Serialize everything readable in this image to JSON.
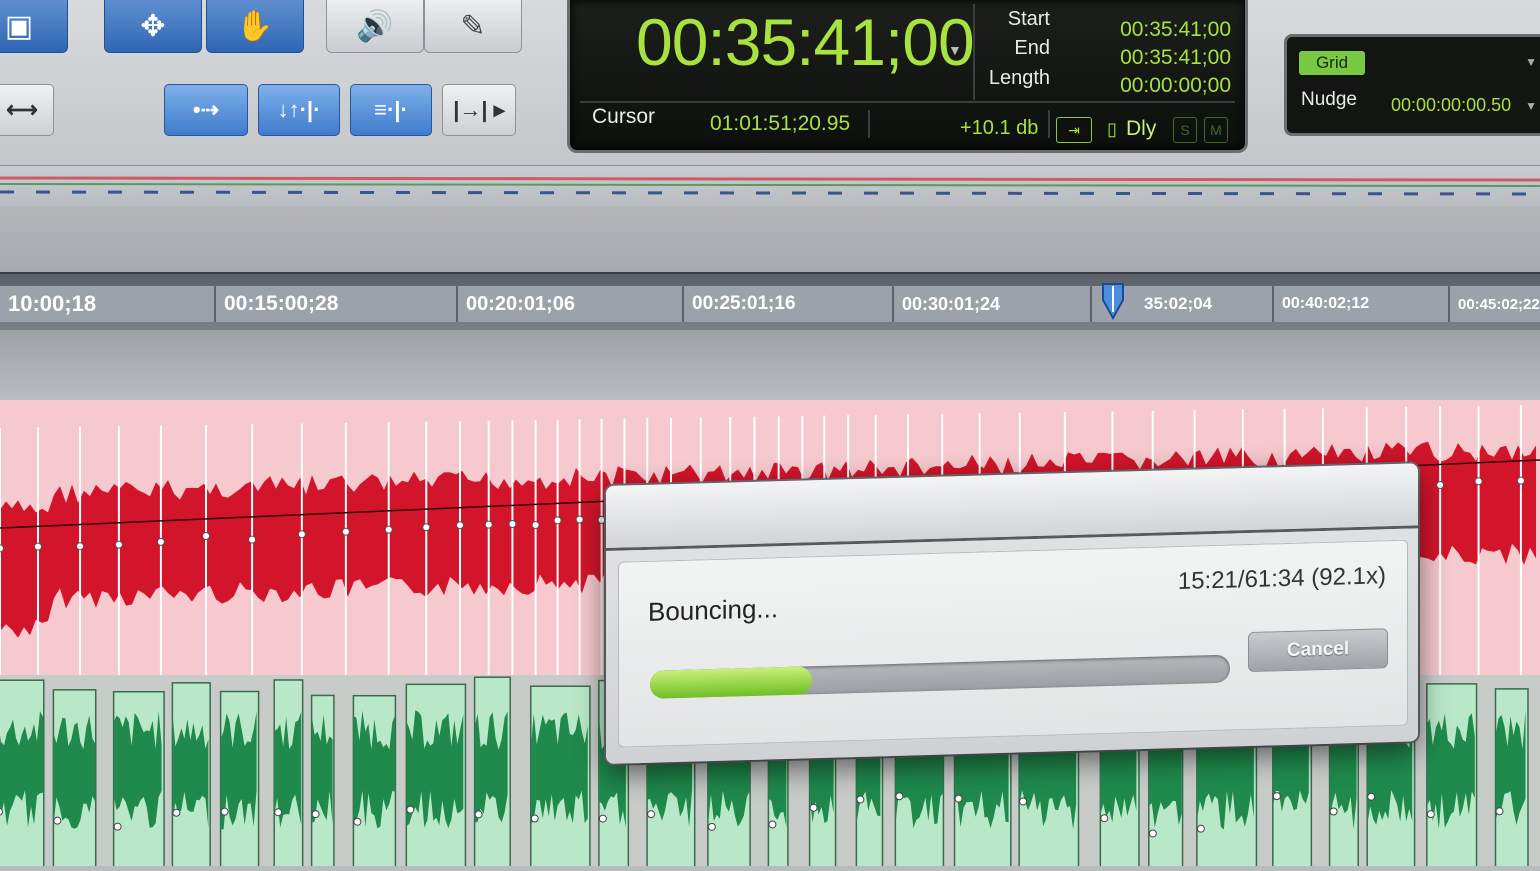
{
  "tools": [
    {
      "icon": "zoom-icon"
    },
    {
      "icon": "trim-icon"
    },
    {
      "icon": "grabber-hand-icon"
    },
    {
      "icon": "speaker-icon"
    },
    {
      "icon": "pencil-icon"
    }
  ],
  "edit_tools": [
    {
      "icon": "link-icon"
    },
    {
      "icon": "spot-icon"
    },
    {
      "icon": "slip-icon"
    },
    {
      "icon": "grid-mode-icon"
    },
    {
      "icon": "nudge-icon"
    }
  ],
  "counter": {
    "main": "00:35:41;00",
    "start_label": "Start",
    "start_value": "00:35:41;00",
    "end_label": "End",
    "end_value": "00:35:41;00",
    "length_label": "Length",
    "length_value": "00:00:00;00",
    "cursor_label": "Cursor",
    "cursor_value": "01:01:51;20.95",
    "gain": "+10.1 db",
    "dly_label": "Dly",
    "s_label": "S",
    "m_label": "M"
  },
  "grid": {
    "grid_label": "Grid",
    "nudge_label": "Nudge",
    "nudge_value": "00:00:00:00.50"
  },
  "ruler": {
    "ticks": [
      "10:00;18",
      "00:15:00;28",
      "00:20:01;06",
      "00:25:01;16",
      "00:30:01;24",
      "35:02;04",
      "00:40:02;12",
      "00:45:02;22"
    ]
  },
  "dialog": {
    "status": "Bouncing...",
    "time": "15:21/61:34 (92.1x)",
    "progress": 0.28,
    "cancel_label": "Cancel"
  },
  "colors": {
    "counter_green": "#a8e23f",
    "track_red": "#d2152b",
    "track_green": "#1f8a4c",
    "tool_blue": "#2f66b4"
  }
}
